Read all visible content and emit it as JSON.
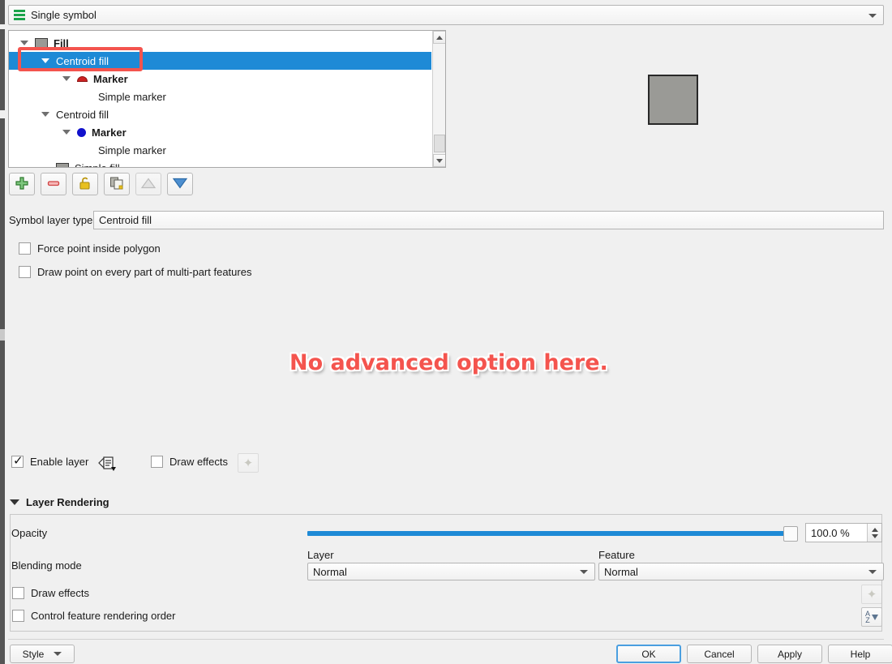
{
  "renderer": {
    "label": "Single symbol",
    "icon": "single-symbol-icon"
  },
  "tree": {
    "items": [
      {
        "label": "Fill",
        "indent": 0,
        "bold": true,
        "icon": "square-fill-icon",
        "expander": true,
        "selected": false
      },
      {
        "label": "Centroid fill",
        "indent": 1,
        "bold": false,
        "icon": "none",
        "expander": true,
        "selected": true
      },
      {
        "label": "Marker",
        "indent": 2,
        "bold": true,
        "icon": "red-dome-icon",
        "expander": true,
        "selected": false
      },
      {
        "label": "Simple marker",
        "indent": 3,
        "bold": false,
        "icon": "none",
        "expander": false,
        "selected": false
      },
      {
        "label": "Centroid fill",
        "indent": 1,
        "bold": false,
        "icon": "none",
        "expander": true,
        "selected": false
      },
      {
        "label": "Marker",
        "indent": 2,
        "bold": true,
        "icon": "blue-dot-icon",
        "expander": true,
        "selected": false
      },
      {
        "label": "Simple marker",
        "indent": 3,
        "bold": false,
        "icon": "none",
        "expander": false,
        "selected": false
      },
      {
        "label": "Simple fill",
        "indent": 1,
        "bold": false,
        "icon": "square-fill-icon",
        "expander": false,
        "selected": false
      }
    ]
  },
  "tree_toolbar": {
    "buttons": [
      {
        "name": "add-symbol-layer-button",
        "icon": "plus-icon",
        "enabled": true
      },
      {
        "name": "remove-symbol-layer-button",
        "icon": "minus-icon",
        "enabled": true
      },
      {
        "name": "lock-layer-colors-button",
        "icon": "unlocked-padlock-icon",
        "enabled": true
      },
      {
        "name": "duplicate-symbol-layer-button",
        "icon": "duplicate-icon",
        "enabled": true
      },
      {
        "name": "move-layer-up-button",
        "icon": "triangle-up-icon",
        "enabled": false
      },
      {
        "name": "move-layer-down-button",
        "icon": "triangle-down-icon",
        "enabled": true
      }
    ]
  },
  "symbol_layer_type": {
    "label": "Symbol layer type",
    "value": "Centroid fill"
  },
  "options": {
    "force_point_inside_polygon": {
      "label": "Force point inside polygon",
      "checked": false
    },
    "draw_point_every_part": {
      "label": "Draw point on every part of multi-part features",
      "checked": false
    }
  },
  "annotation": {
    "text": "No advanced option here.",
    "color": "#f4544e"
  },
  "layer_controls": {
    "enable_layer": {
      "label": "Enable layer",
      "checked": true
    },
    "enable_layer_override_icon": "data-defined-override-icon",
    "draw_effects": {
      "label": "Draw effects",
      "checked": false
    },
    "draw_effects_button_icon": "effects-star-icon"
  },
  "layer_rendering": {
    "title": "Layer Rendering",
    "expanded": true,
    "opacity": {
      "label": "Opacity",
      "value": "100.0 %",
      "percent": 100
    },
    "blending_mode": {
      "label": "Blending mode",
      "layer_label": "Layer",
      "layer_value": "Normal",
      "feature_label": "Feature",
      "feature_value": "Normal"
    },
    "draw_effects": {
      "label": "Draw effects",
      "checked": false
    },
    "control_feature_rendering_order": {
      "label": "Control feature rendering order",
      "checked": false
    },
    "effects_button_icon": "effects-star-icon",
    "order_button_icon": "sort-az-icon"
  },
  "footer": {
    "style_button": "Style",
    "ok_button": "OK",
    "cancel_button": "Cancel",
    "apply_button": "Apply",
    "help_button": "Help"
  },
  "colors": {
    "selection": "#1e8ad6",
    "highlight": "#f4544e",
    "symbol_preview_fill": "#9a9a96"
  }
}
